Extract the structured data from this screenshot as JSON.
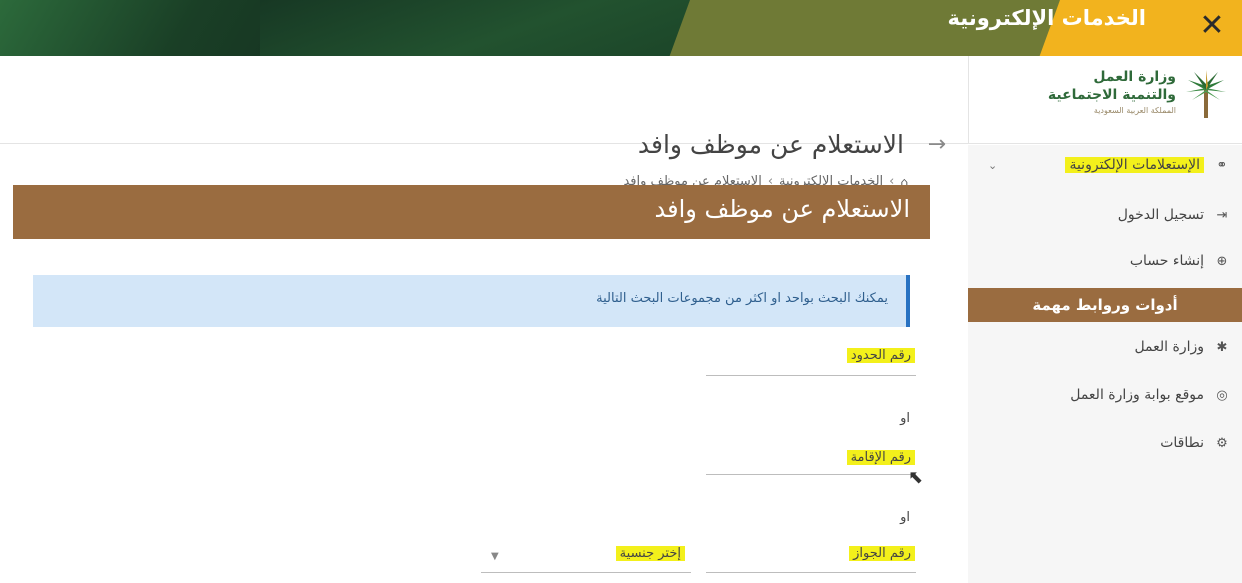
{
  "banner": {
    "title": "الخدمات الإلكترونية",
    "close_icon": "close-icon"
  },
  "logo": {
    "line1": "وزارة العمل",
    "line2": "والتنمية الاجتماعية",
    "line3": "المملكة العربية السعودية"
  },
  "header": {
    "title": "الاستعلام عن موظف وافد",
    "back_icon": "arrow-right-icon",
    "breadcrumb": {
      "home_icon": "home-icon",
      "items": [
        "الخدمات الإلكترونية",
        "الاستعلام عن موظف وافد"
      ],
      "separator": "›"
    }
  },
  "sidebar": {
    "items": [
      {
        "label": "الإستعلامات الإلكترونية",
        "icon": "share-nodes-icon"
      },
      {
        "label": "تسجيل الدخول",
        "icon": "login-icon"
      },
      {
        "label": "إنشاء حساب",
        "icon": "plus-circle-icon"
      }
    ],
    "section_title": "أدوات وروابط مهمة",
    "links": [
      {
        "label": "وزارة العمل",
        "icon": "palm-icon"
      },
      {
        "label": "موقع بوابة وزارة العمل",
        "icon": "globe-icon"
      },
      {
        "label": "نطاقات",
        "icon": "gear-icon"
      }
    ]
  },
  "card": {
    "title": "الاستعلام عن موظف وافد",
    "info": "يمكنك البحث بواحد او اكثر من مجموعات البحث التالية",
    "fields": {
      "border_no": "رقم الحدود",
      "or1": "او",
      "iqama_no": "رقم الإقامة",
      "or2": "او",
      "passport_no": "رقم الجواز",
      "nationality": "إختر جنسية"
    }
  },
  "colors": {
    "banner_green": "#1f4a2c",
    "banner_yellow": "#f2b31e",
    "brown": "#9a6c40",
    "info_bg": "#d3e6f8",
    "highlight": "#f3f01b"
  }
}
